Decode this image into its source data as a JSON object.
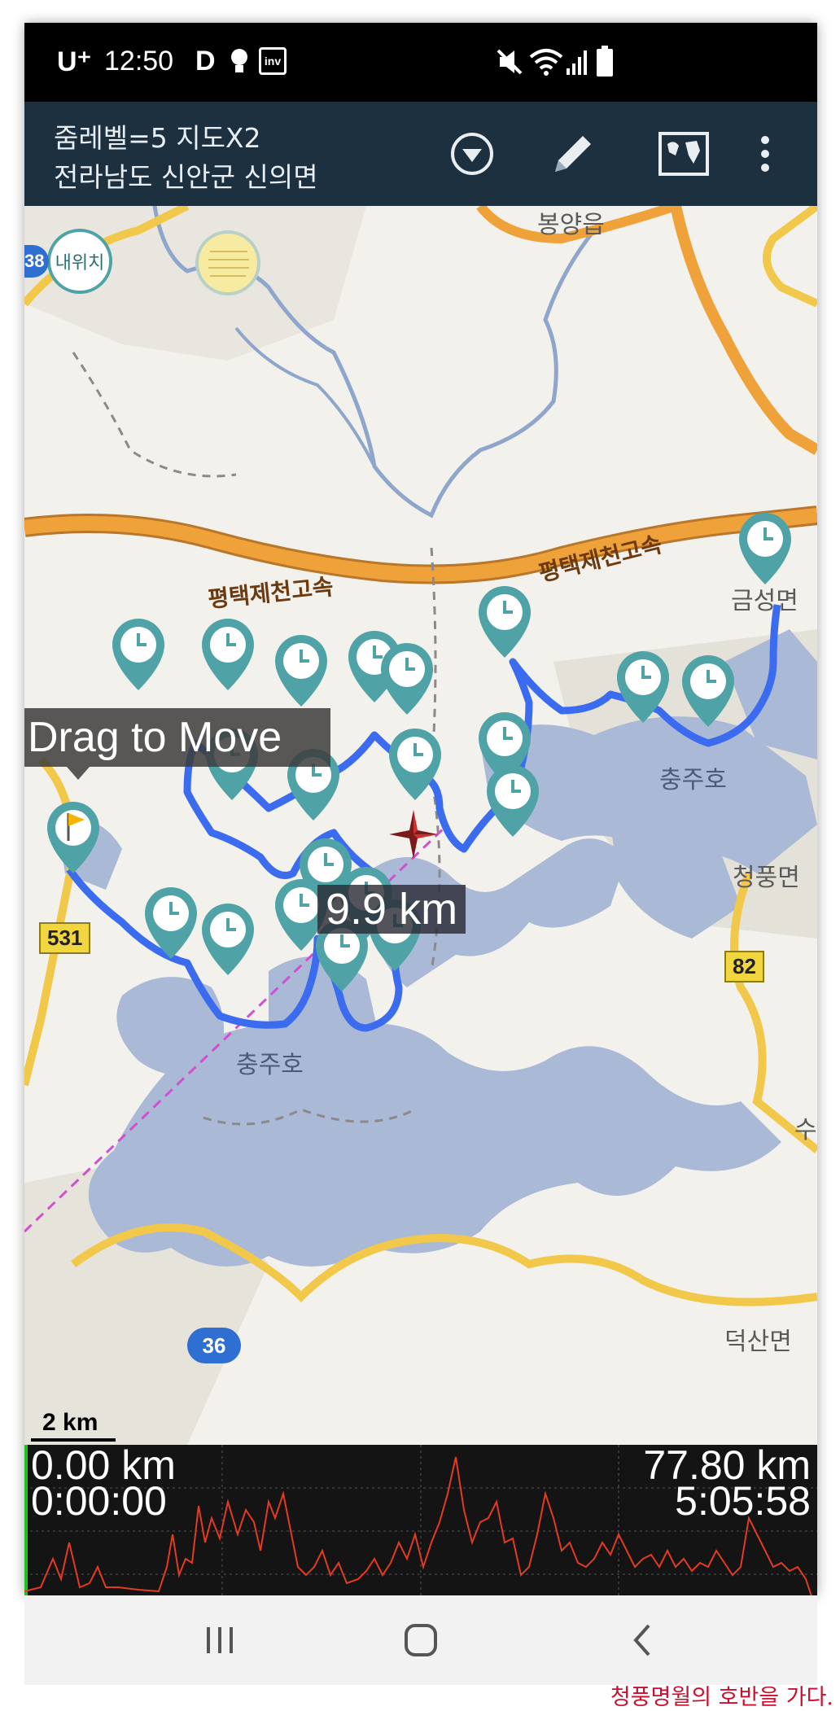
{
  "status_bar": {
    "carrier": "U⁺",
    "time": "12:50",
    "app_icon_d": "D",
    "app_icon_inv": "inv"
  },
  "app_bar": {
    "line1": "줌레벨=5 지도X2",
    "line2": "전라남도 신안군 신의면",
    "icons": [
      "dropdown-circle-icon",
      "pencil-icon",
      "world-map-icon",
      "more-vert-icon"
    ]
  },
  "map": {
    "my_location_button": "내위치",
    "drag_tooltip": "Drag to Move",
    "distance_label": "9.9 km",
    "scale_label": "2 km",
    "place_labels": [
      "봉양읍",
      "금성면",
      "충주호",
      "청풍면",
      "충주호",
      "덕산면",
      "수"
    ],
    "highway_labels": [
      "평택제천고속",
      "평택제천고속"
    ],
    "road_shields": [
      "38",
      "531",
      "82",
      "36"
    ],
    "colors": {
      "track": "#3b6cf0",
      "marker": "#4fa3a6",
      "water": "#a9b9d6",
      "highway": "#f0a23a",
      "measure_line": "#d050d0"
    }
  },
  "elevation": {
    "start_distance": "0.00 km",
    "end_distance": "77.80 km",
    "start_time": "0:00:00",
    "end_time": "5:05:58",
    "line_color": "#e53a22"
  },
  "nav_bar": {
    "icons": [
      "recent-apps-icon",
      "home-icon",
      "back-icon"
    ]
  },
  "caption": "청풍명월의 호반을 가다."
}
